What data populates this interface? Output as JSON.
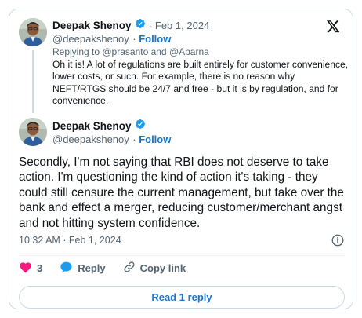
{
  "parent_tweet": {
    "author_name": "Deepak Shenoy",
    "date": "Feb 1, 2024",
    "handle": "@deepakshenoy",
    "follow_label": "Follow",
    "replying_to": "Replying to @prasanto and @Aparna",
    "text": "Oh it is! A lot of regulations are built entirely for customer convenience, lower costs, or such. For example, there is no reason why NEFT/RTGS should be 24/7 and free - but it is by regulation, and for convenience."
  },
  "main_tweet": {
    "author_name": "Deepak Shenoy",
    "handle": "@deepakshenoy",
    "follow_label": "Follow",
    "text": "Secondly, I'm not saying that RBI does not deserve to take action. I'm questioning the kind of action it's taking - they could still censure the current management, but take over the bank and effect a merger, reducing customer/merchant angst and not hitting system confidence.",
    "timestamp": "10:32 AM · Feb 1, 2024"
  },
  "actions": {
    "like_count": "3",
    "reply_label": "Reply",
    "copy_link_label": "Copy link"
  },
  "read_replies_label": "Read 1 reply",
  "icons": {
    "brand": "x-logo-icon",
    "verified": "verified-badge-icon",
    "like": "heart-icon",
    "reply": "speech-bubble-icon",
    "link": "link-icon",
    "info": "info-icon"
  },
  "colors": {
    "accent": "#1d74c9",
    "verified": "#1d9bf0",
    "like": "#f91880",
    "muted_text": "#536471",
    "border": "#cfd9de"
  }
}
